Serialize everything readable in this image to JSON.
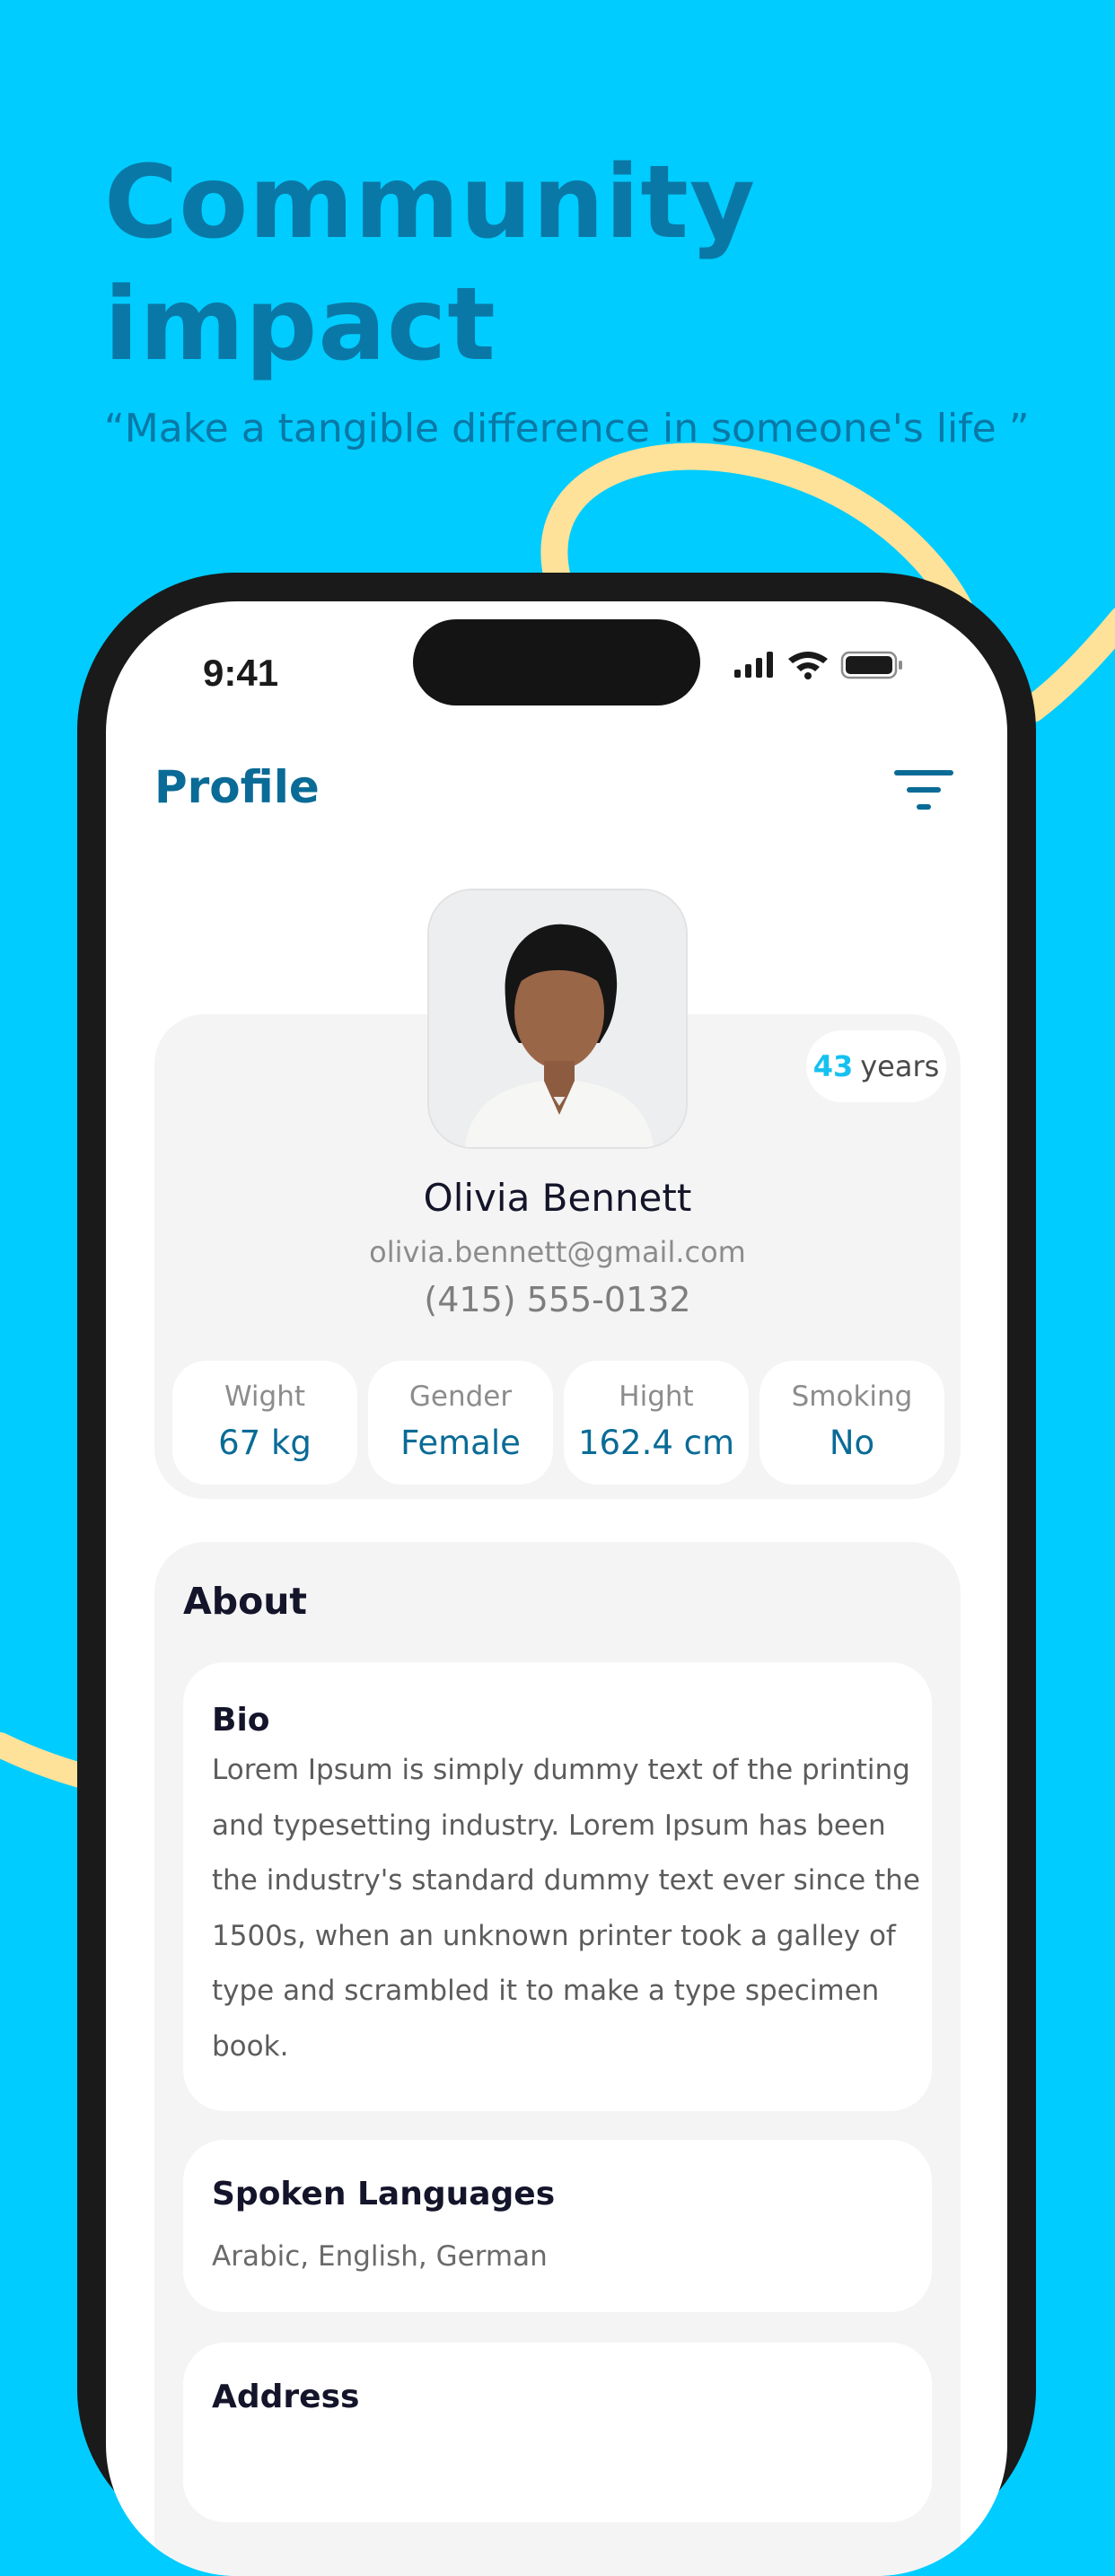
{
  "hero": {
    "title_line1": "Community",
    "title_line2": "impact",
    "quote": "“Make a tangible difference in someone's life ”"
  },
  "status_bar": {
    "time": "9:41"
  },
  "header": {
    "title": "Profile",
    "filter_icon": "filter-icon"
  },
  "profile": {
    "age_value": "43",
    "age_unit": "years",
    "name": "Olivia Bennett",
    "email": "olivia.bennett@gmail.com",
    "phone": "(415) 555-0132",
    "stats": [
      {
        "label": "Wight",
        "value": "67 kg"
      },
      {
        "label": "Gender",
        "value": "Female"
      },
      {
        "label": "Hight",
        "value": "162.4 cm"
      },
      {
        "label": "Smoking",
        "value": "No"
      }
    ]
  },
  "about": {
    "title": "About",
    "bio": {
      "title": "Bio",
      "lines": [
        "Lorem Ipsum is simply dummy text of the printing",
        "and typesetting industry. Lorem Ipsum has been",
        "the industry's standard dummy text ever since the",
        "1500s, when an unknown printer took a galley of",
        "type and scrambled it to make a type specimen",
        "book."
      ]
    },
    "languages": {
      "title": "Spoken Languages",
      "value": "Arabic, English, German"
    },
    "address": {
      "title": "Address"
    }
  },
  "colors": {
    "background": "#00CCFF",
    "accent_dark": "#0A6B96",
    "accent_light": "#16C1F0",
    "decor_curve": "#FFE299",
    "card_bg": "#F4F4F4"
  }
}
